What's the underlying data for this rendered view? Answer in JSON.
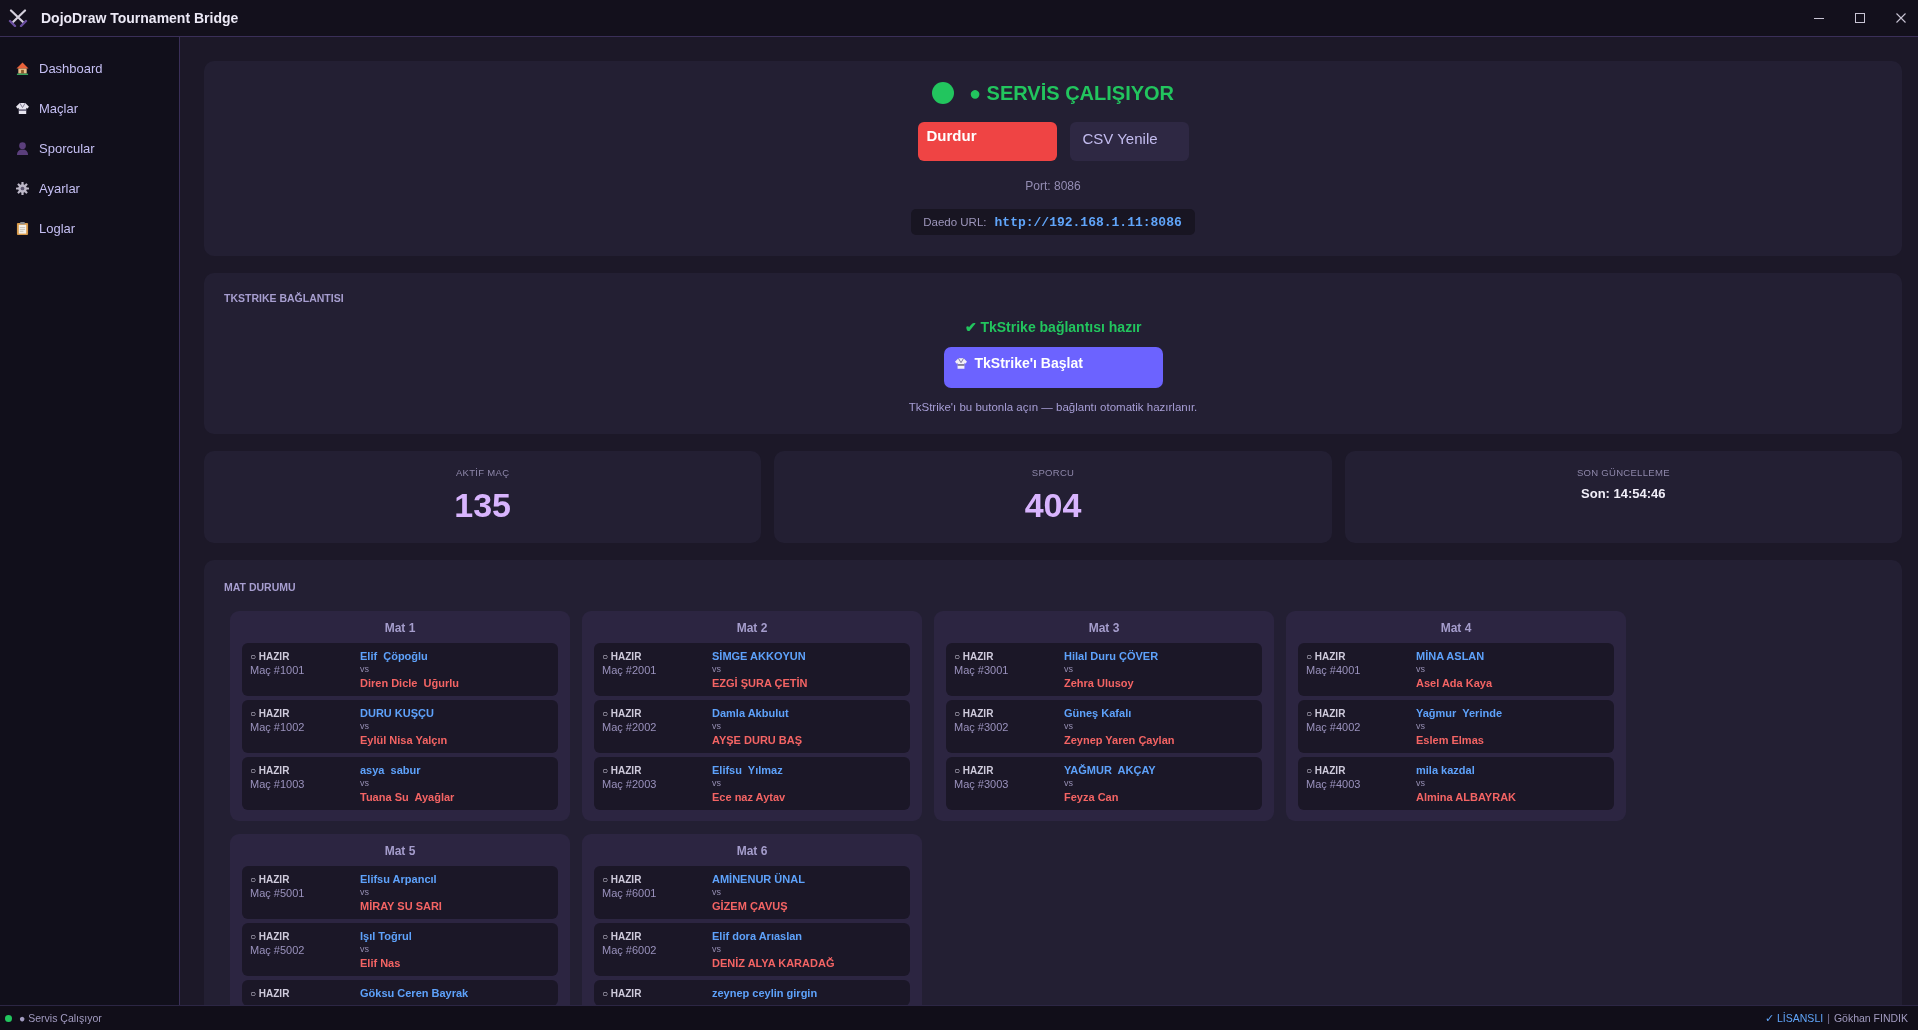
{
  "window": {
    "title": "DojoDraw Tournament Bridge"
  },
  "sidebar": {
    "items": [
      {
        "label": "Dashboard"
      },
      {
        "label": "Maçlar"
      },
      {
        "label": "Sporcular"
      },
      {
        "label": "Ayarlar"
      },
      {
        "label": "Loglar"
      }
    ]
  },
  "service": {
    "running": true,
    "status": "● SERVİS ÇALIŞIYOR",
    "buttons": [
      {
        "label": "Durdur",
        "kind": "danger"
      },
      {
        "label": "CSV Yenile",
        "kind": "secondary"
      }
    ],
    "port": "Port: 8086",
    "url_label": "Daedo URL:",
    "url": "http://192.168.1.11:8086"
  },
  "tkstrike": {
    "title": "TKSTRIKE BAĞLANTISI",
    "ready": true,
    "status": "✔ TkStrike bağlantısı hazır",
    "button": "TkStrike'ı Başlat",
    "hint": "TkStrike'ı bu butonla açın — bağlantı otomatik hazırlanır."
  },
  "stats": [
    {
      "label": "AKTİF MAÇ",
      "value": "135",
      "kind": "count"
    },
    {
      "label": "SPORCU",
      "value": "404",
      "kind": "count"
    },
    {
      "label": "SON GÜNCELLEME",
      "value": "Son: 14:54:46",
      "kind": "time"
    }
  ],
  "mats": {
    "title": "MAT DURUMU",
    "items": [
      {
        "name": "Mat 1",
        "matches": [
          {
            "status": "○ HAZIR",
            "id": "Maç #1001",
            "athlete_1": "Elif  Çöpoğlu",
            "vs": "vs",
            "athlete_2": "Diren Dicle  Uğurlu"
          },
          {
            "status": "○ HAZIR",
            "id": "Maç #1002",
            "athlete_1": "DURU KUŞÇU",
            "vs": "vs",
            "athlete_2": "Eylül Nisa Yalçın"
          },
          {
            "status": "○ HAZIR",
            "id": "Maç #1003",
            "athlete_1": "asya  sabur",
            "vs": "vs",
            "athlete_2": "Tuana Su  Ayağlar"
          }
        ]
      },
      {
        "name": "Mat 2",
        "matches": [
          {
            "status": "○ HAZIR",
            "id": "Maç #2001",
            "athlete_1": "SİMGE AKKOYUN",
            "vs": "vs",
            "athlete_2": "EZGİ ŞURA ÇETİN"
          },
          {
            "status": "○ HAZIR",
            "id": "Maç #2002",
            "athlete_1": "Damla Akbulut",
            "vs": "vs",
            "athlete_2": "AYŞE DURU BAŞ"
          },
          {
            "status": "○ HAZIR",
            "id": "Maç #2003",
            "athlete_1": "Elifsu  Yılmaz",
            "vs": "vs",
            "athlete_2": "Ece naz Aytav"
          }
        ]
      },
      {
        "name": "Mat 3",
        "matches": [
          {
            "status": "○ HAZIR",
            "id": "Maç #3001",
            "athlete_1": "Hilal Duru ÇÖVER",
            "vs": "vs",
            "athlete_2": "Zehra Ulusoy"
          },
          {
            "status": "○ HAZIR",
            "id": "Maç #3002",
            "athlete_1": "Güneş Kafalı",
            "vs": "vs",
            "athlete_2": "Zeynep Yaren Çaylan"
          },
          {
            "status": "○ HAZIR",
            "id": "Maç #3003",
            "athlete_1": "YAĞMUR  AKÇAY",
            "vs": "vs",
            "athlete_2": "Feyza Can"
          }
        ]
      },
      {
        "name": "Mat 4",
        "matches": [
          {
            "status": "○ HAZIR",
            "id": "Maç #4001",
            "athlete_1": "MİNA ASLAN",
            "vs": "vs",
            "athlete_2": "Asel Ada Kaya"
          },
          {
            "status": "○ HAZIR",
            "id": "Maç #4002",
            "athlete_1": "Yağmur  Yerinde",
            "vs": "vs",
            "athlete_2": "Eslem Elmas"
          },
          {
            "status": "○ HAZIR",
            "id": "Maç #4003",
            "athlete_1": "mila kazdal",
            "vs": "vs",
            "athlete_2": "Almina ALBAYRAK"
          }
        ]
      },
      {
        "name": "Mat 5",
        "matches": [
          {
            "status": "○ HAZIR",
            "id": "Maç #5001",
            "athlete_1": "Elifsu Arpancıl",
            "vs": "vs",
            "athlete_2": "MİRAY SU SARI"
          },
          {
            "status": "○ HAZIR",
            "id": "Maç #5002",
            "athlete_1": "Işıl Toğrul",
            "vs": "vs",
            "athlete_2": "Elif Nas"
          },
          {
            "status": "○ HAZIR",
            "athlete_1": "Göksu Ceren Bayrak"
          }
        ]
      },
      {
        "name": "Mat 6",
        "matches": [
          {
            "status": "○ HAZIR",
            "id": "Maç #6001",
            "athlete_1": "AMİNENUR ÜNAL",
            "vs": "vs",
            "athlete_2": "GİZEM ÇAVUŞ"
          },
          {
            "status": "○ HAZIR",
            "id": "Maç #6002",
            "athlete_1": "Elif dora Arıaslan",
            "vs": "vs",
            "athlete_2": "DENİZ ALYA KARADAĞ"
          },
          {
            "status": "○ HAZIR",
            "athlete_1": "zeynep ceylin girgin"
          }
        ]
      }
    ]
  },
  "status_bar": {
    "running": true,
    "text": "● Servis Çalışıyor",
    "license": "✓ LİSANSLI",
    "separator": "|",
    "user": "Gökhan FINDIK"
  }
}
